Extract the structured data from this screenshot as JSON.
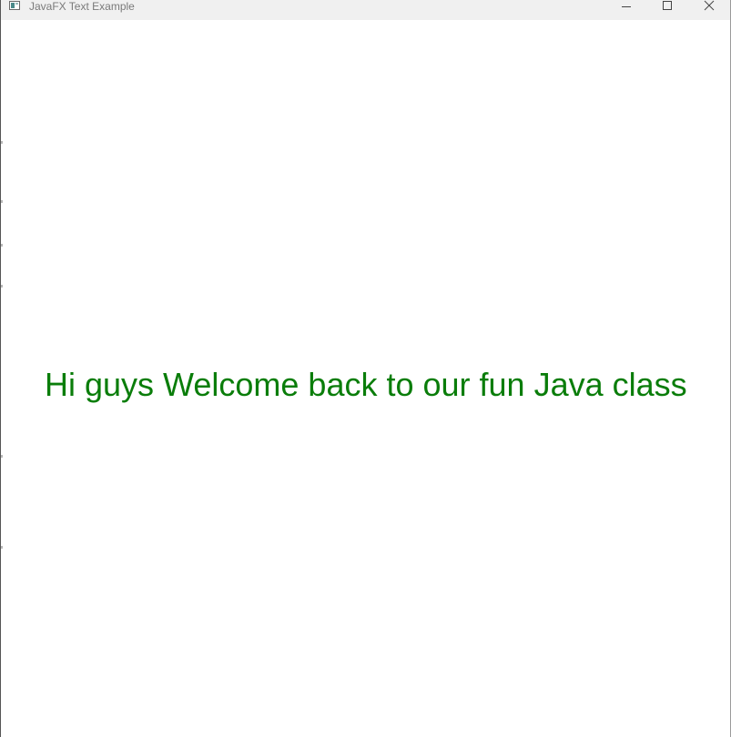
{
  "window": {
    "title": "JavaFX Text Example",
    "app_icon": "javafx-app-icon",
    "controls": {
      "minimize_icon": "minimize-icon",
      "maximize_icon": "maximize-icon",
      "close_icon": "close-icon"
    }
  },
  "content": {
    "message": "Hi guys Welcome back to our fun Java class",
    "message_color": "#0a7d0a"
  },
  "colors": {
    "titlebar_bg": "#f0f0f0",
    "content_bg": "#ffffff"
  }
}
